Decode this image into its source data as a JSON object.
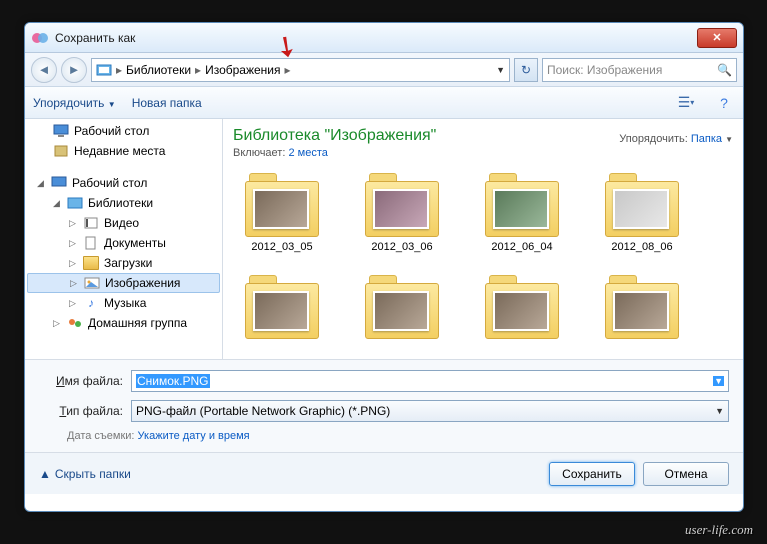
{
  "window": {
    "title": "Сохранить как"
  },
  "breadcrumb": {
    "root": "Библиотеки",
    "current": "Изображения"
  },
  "search": {
    "placeholder": "Поиск: Изображения"
  },
  "toolbar": {
    "organize": "Упорядочить",
    "newfolder": "Новая папка"
  },
  "sidebar": {
    "fav": [
      {
        "label": "Рабочий стол"
      },
      {
        "label": "Недавние места"
      }
    ],
    "desktop": "Рабочий стол",
    "libraries": "Библиотеки",
    "libs": [
      {
        "label": "Видео"
      },
      {
        "label": "Документы"
      },
      {
        "label": "Загрузки"
      },
      {
        "label": "Изображения"
      },
      {
        "label": "Музыка"
      }
    ],
    "homegroup": "Домашняя группа"
  },
  "library": {
    "title": "Библиотека \"Изображения\"",
    "includes_pre": "Включает:",
    "includes_link": "2 места",
    "arrange_pre": "Упорядочить:",
    "arrange_val": "Папка"
  },
  "items": [
    {
      "name": "2012_03_05"
    },
    {
      "name": "2012_03_06"
    },
    {
      "name": "2012_06_04"
    },
    {
      "name": "2012_08_06"
    }
  ],
  "form": {
    "filename_label_pre": "Имя файла:",
    "filename_key": "И",
    "filename_value": "Снимок.PNG",
    "filetype_label_pre": "Тип файла:",
    "filetype_key": "Т",
    "filetype_value": "PNG-файл (Portable Network Graphic) (*.PNG)",
    "meta_label": "Дата съемки:",
    "meta_link": "Укажите дату и время"
  },
  "footer": {
    "hide": "Скрыть папки",
    "save": "Сохранить",
    "cancel": "Отмена"
  },
  "credit": "user-life.com"
}
